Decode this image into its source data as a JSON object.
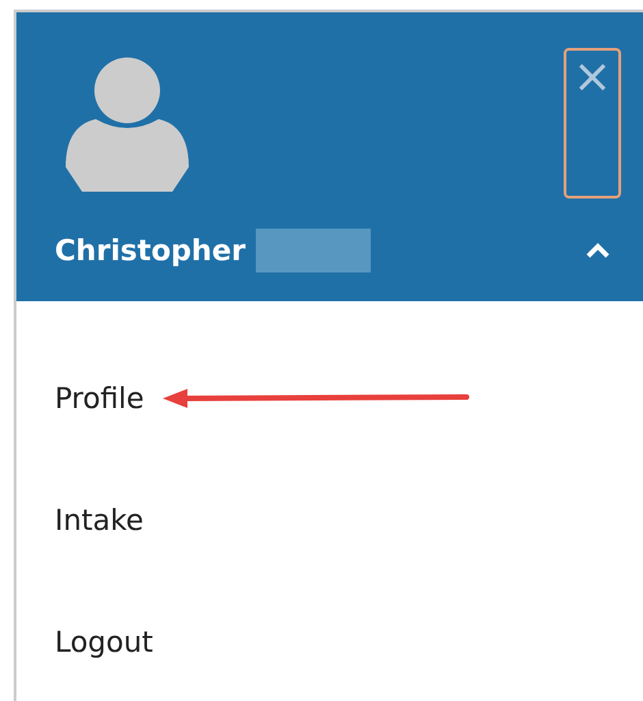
{
  "header": {
    "user_name": "Christopher",
    "name_redacted": true,
    "expanded": true,
    "close_label": "×"
  },
  "menu": [
    {
      "label": "Profile",
      "arrow": true
    },
    {
      "label": "Intake",
      "arrow": false
    },
    {
      "label": "Logout",
      "arrow": false
    }
  ]
}
